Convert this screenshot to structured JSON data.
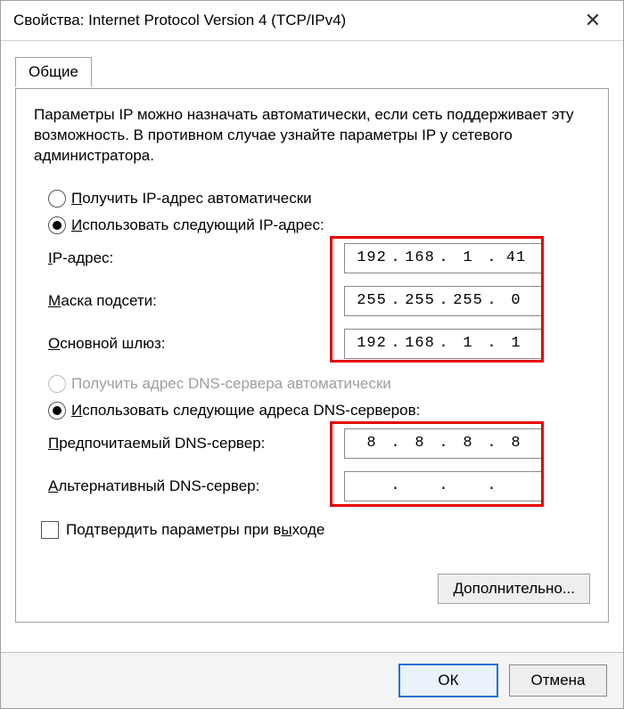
{
  "window": {
    "title": "Свойства: Internet Protocol Version 4 (TCP/IPv4)"
  },
  "tab": {
    "label": "Общие"
  },
  "description": "Параметры IP можно назначать автоматически, если сеть поддерживает эту возможность. В противном случае узнайте параметры IP у сетевого администратора.",
  "ip_section": {
    "auto_prefix": "П",
    "auto_rest": "олучить IP-адрес автоматически",
    "manual_prefix": "И",
    "manual_rest": "спользовать следующий IP-адрес:",
    "ip_label_prefix": "I",
    "ip_label_rest": "P-адрес:",
    "mask_label_prefix": "М",
    "mask_label_rest": "аска подсети:",
    "gw_label_prefix": "О",
    "gw_label_rest": "сновной шлюз:",
    "ip": {
      "o1": "192",
      "o2": "168",
      "o3": "1",
      "o4": "41"
    },
    "mask": {
      "o1": "255",
      "o2": "255",
      "o3": "255",
      "o4": "0"
    },
    "gw": {
      "o1": "192",
      "o2": "168",
      "o3": "1",
      "o4": "1"
    }
  },
  "dns_section": {
    "auto_label": "Получить адрес DNS-сервера автоматически",
    "manual_prefix": "И",
    "manual_rest": "спользовать следующие адреса DNS-серверов:",
    "pref_label_prefix": "П",
    "pref_label_rest": "редпочитаемый DNS-сервер:",
    "alt_label_prefix": "А",
    "alt_label_rest": "льтернативный DNS-сервер:",
    "pref": {
      "o1": "8",
      "o2": "8",
      "o3": "8",
      "o4": "8"
    },
    "alt": {
      "o1": "",
      "o2": "",
      "o3": "",
      "o4": ""
    }
  },
  "validate": {
    "prefix": "Подтвердить параметры при в",
    "ul": "ы",
    "rest": "ходе"
  },
  "advanced": {
    "prefix": "Д",
    "rest": "ополнительно..."
  },
  "buttons": {
    "ok": "ОК",
    "cancel": "Отмена"
  }
}
